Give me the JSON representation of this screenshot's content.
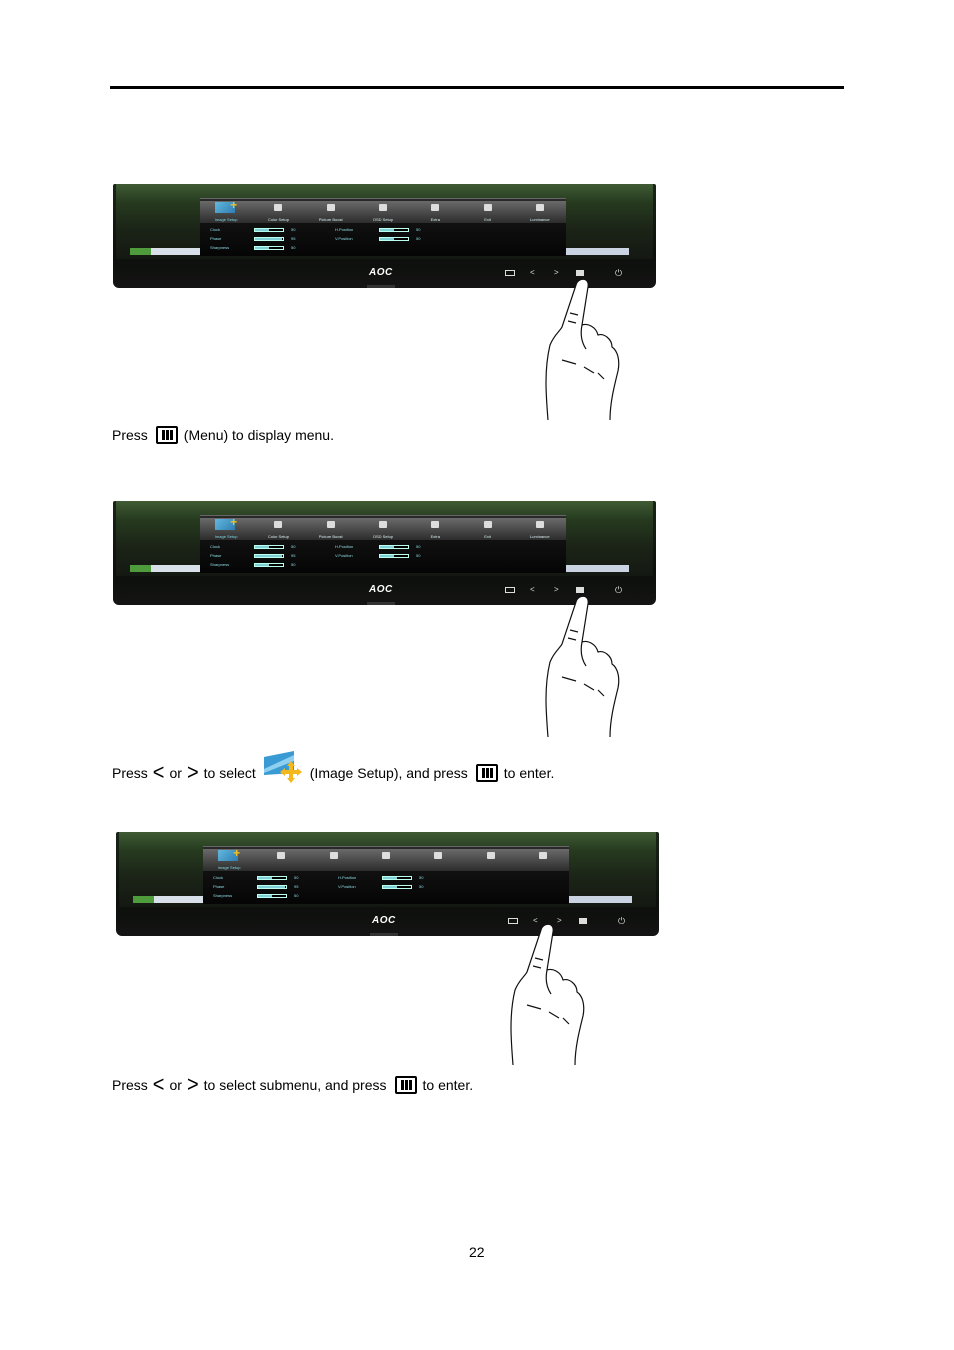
{
  "page": {
    "number": "22"
  },
  "monitor": {
    "brand": "AOC",
    "osd": {
      "tabs": [
        "Image Setup",
        "Color Setup",
        "Picture Boost",
        "OSD Setup",
        "Extra",
        "Exit",
        "Luminance"
      ],
      "active_tab": "Image Setup",
      "left_items": [
        {
          "label": "Clock",
          "value": "50",
          "level": 0.5
        },
        {
          "label": "Phase",
          "value": "95",
          "level": 0.95
        },
        {
          "label": "Sharpness",
          "value": "50",
          "level": 0.5
        }
      ],
      "right_items": [
        {
          "label": "H.Position",
          "value": "50",
          "level": 0.5
        },
        {
          "label": "V.Position",
          "value": "50",
          "level": 0.5
        }
      ]
    },
    "buttons": [
      "source-auto",
      "left",
      "right",
      "menu",
      "power"
    ]
  },
  "steps": [
    {
      "pressed_button": "menu",
      "text_parts": [
        "Press",
        "(Menu) to display menu."
      ],
      "icons": [
        "menu-key-icon"
      ]
    },
    {
      "pressed_button": "menu",
      "text_parts": [
        "Press",
        "or",
        "to select",
        "(Image Setup), and press",
        "to enter."
      ],
      "icons": [
        "chevron-left-icon",
        "chevron-right-icon",
        "image-setup-icon",
        "menu-key-icon"
      ]
    },
    {
      "pressed_button": "right",
      "text_parts": [
        "Press",
        "or",
        "to select submenu, and press",
        "to enter."
      ],
      "icons": [
        "chevron-left-icon",
        "chevron-right-icon",
        "menu-key-icon"
      ]
    }
  ],
  "glyphs": {
    "chevron_left": "<",
    "chevron_right": ">"
  },
  "colors": {
    "osd_text": "#8fdde6",
    "accent_blue": "#2f7db2",
    "accent_yellow": "#f0c020"
  }
}
